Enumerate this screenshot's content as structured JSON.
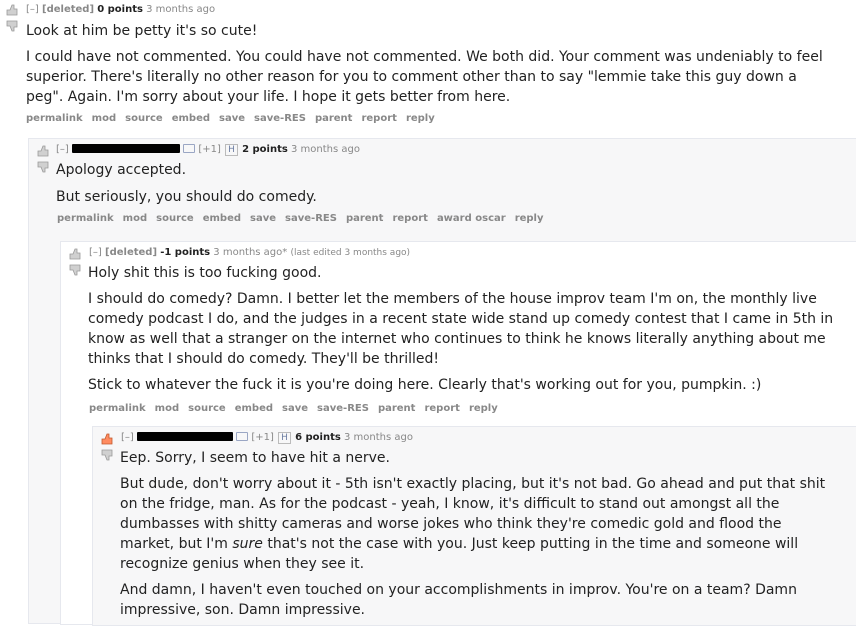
{
  "c1": {
    "expand": "[–]",
    "author": "[deleted]",
    "score": "0 points",
    "time": "3 months ago",
    "paragraphs": [
      "Look at him be petty it's so cute!",
      "I could have not commented. You could have not commented. We both did. Your comment was undeniably to feel superior. There's literally no other reason for you to comment other than to say \"lemmie take this guy down a peg\". Again. I'm sorry about your life. I hope it gets better from here."
    ],
    "buttons": [
      "permalink",
      "mod",
      "source",
      "embed",
      "save",
      "save-RES",
      "parent",
      "report",
      "reply"
    ]
  },
  "c2": {
    "expand": "[–]",
    "plus": "[+1]",
    "h": "H",
    "score": "2 points",
    "time": "3 months ago",
    "paragraphs": [
      "Apology accepted.",
      "But seriously, you should do comedy."
    ],
    "buttons": [
      "permalink",
      "mod",
      "source",
      "embed",
      "save",
      "save-RES",
      "parent",
      "report",
      "award oscar",
      "reply"
    ]
  },
  "c3": {
    "expand": "[–]",
    "author": "[deleted]",
    "score": "-1 points",
    "time": "3 months ago*",
    "edited": "(last edited 3 months ago)",
    "paragraphs": [
      "Holy shit this is too fucking good.",
      "I should do comedy? Damn. I better let the members of the house improv team I'm on, the monthly live comedy podcast I do, and the judges in a recent state wide stand up comedy contest that I came in 5th in know as well that a stranger on the internet who continues to think he knows literally anything about me thinks that I should do comedy. They'll be thrilled!",
      "Stick to whatever the fuck it is you're doing here. Clearly that's working out for you, pumpkin. :)"
    ],
    "buttons": [
      "permalink",
      "mod",
      "source",
      "embed",
      "save",
      "save-RES",
      "parent",
      "report",
      "reply"
    ]
  },
  "c4": {
    "expand": "[–]",
    "plus": "[+1]",
    "h": "H",
    "score": "6 points",
    "time": "3 months ago",
    "p1": "Eep. Sorry, I seem to have hit a nerve.",
    "p2_a": "But dude, don't worry about it - 5th isn't exactly placing, but it's not bad. Go ahead and put that shit on the fridge, man. As for the podcast - yeah, I know, it's difficult to stand out amongst all the dumbasses with shitty cameras and worse jokes who think they're comedic gold and flood the market, but I'm ",
    "p2_em": "sure",
    "p2_b": " that's not the case with you. Just keep putting in the time and someone will recognize genius when they see it.",
    "p3": "And damn, I haven't even touched on your accomplishments in improv. You're on a team? Damn impressive, son. Damn impressive."
  },
  "colors": {
    "upvoted": "#ff8b60",
    "arrow": "#c6c6c6",
    "link": "#888888"
  }
}
